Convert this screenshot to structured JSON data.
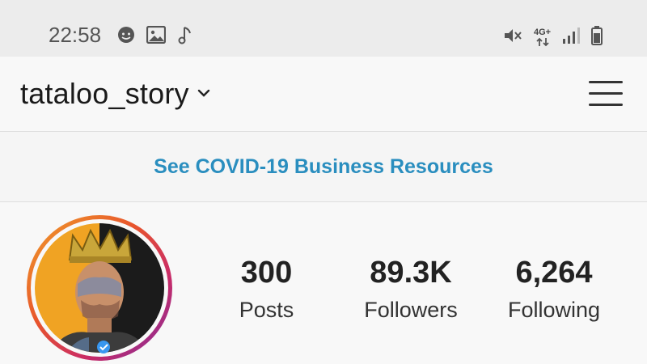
{
  "status_bar": {
    "time": "22:58",
    "network_type": "4G+",
    "left_icons": [
      "messenger-icon",
      "image-icon",
      "music-note-icon"
    ],
    "right_icons": [
      "mute-icon",
      "network-arrows-icon",
      "signal-icon",
      "battery-icon"
    ]
  },
  "header": {
    "username": "tataloo_story",
    "dropdown_icon": "chevron-down-icon",
    "menu_icon": "hamburger-menu-icon"
  },
  "banner": {
    "text": "See COVID-19 Business Resources",
    "color": "#2a8ebf"
  },
  "profile": {
    "verified": true,
    "stats": [
      {
        "value": "300",
        "label": "Posts"
      },
      {
        "value": "89.3K",
        "label": "Followers"
      },
      {
        "value": "6,264",
        "label": "Following"
      }
    ]
  }
}
